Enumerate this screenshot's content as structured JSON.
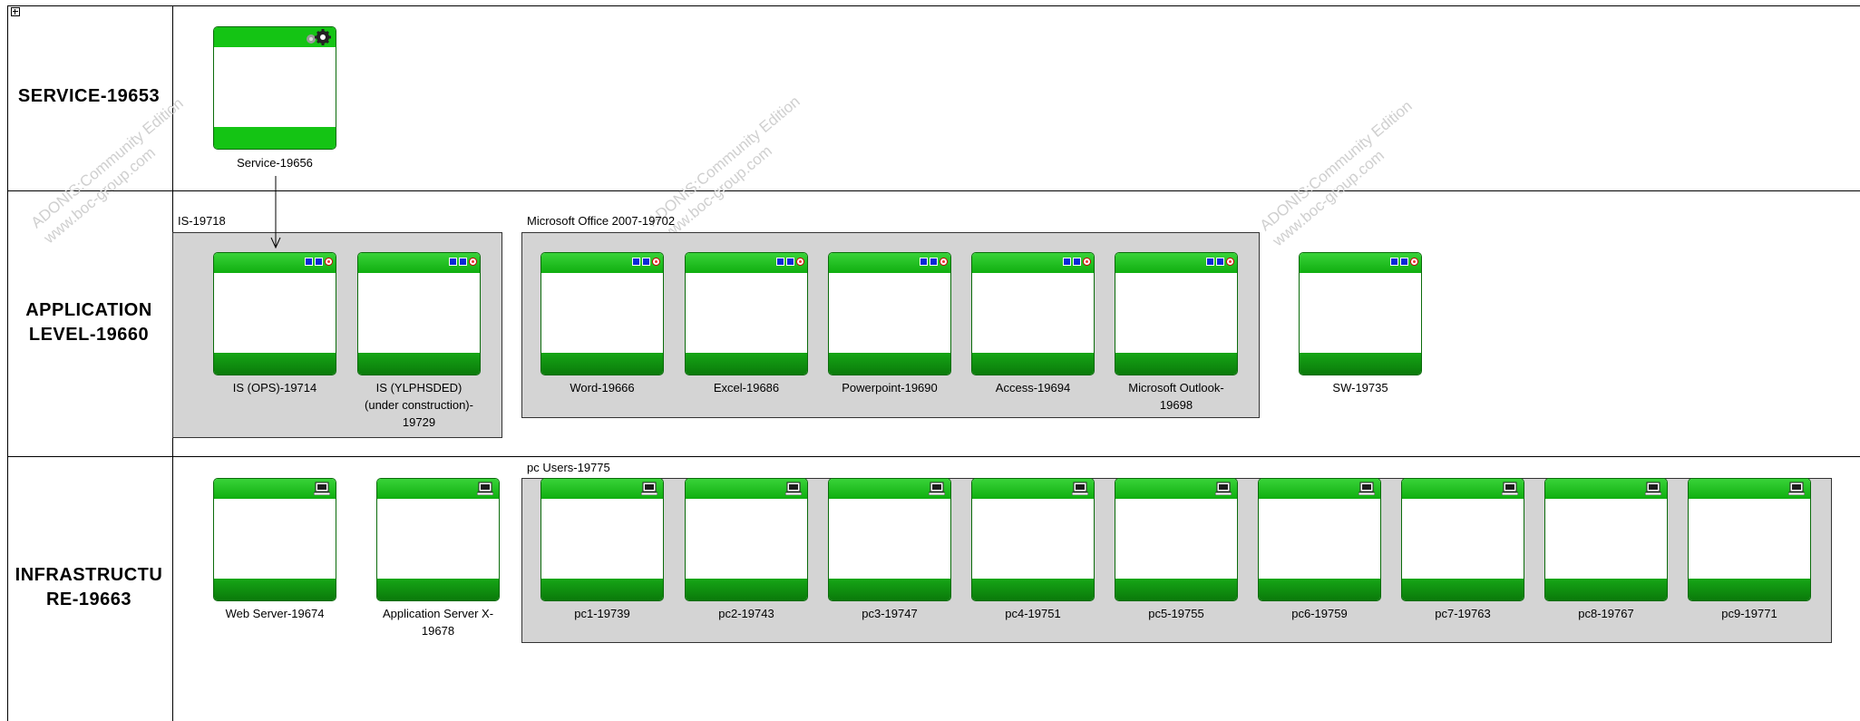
{
  "lanes": [
    {
      "label": "SERVICE-19653"
    },
    {
      "label": "APPLICATION\nLEVEL-19660"
    },
    {
      "label": "INFRASTRUCTU\nRE-19663"
    }
  ],
  "groups": {
    "is": "IS-19718",
    "office": "Microsoft Office 2007-19702",
    "pc_users": "pc Users-19775"
  },
  "service": {
    "label": "Service-19656",
    "icon": "gear-icon"
  },
  "applications": [
    {
      "label": "IS (OPS)-19714"
    },
    {
      "label": "IS (YLPHSDED)\n(under construction)-\n19729"
    },
    {
      "label": "Word-19666"
    },
    {
      "label": "Excel-19686"
    },
    {
      "label": "Powerpoint-19690"
    },
    {
      "label": "Access-19694"
    },
    {
      "label": "Microsoft Outlook-\n19698"
    },
    {
      "label": "SW-19735"
    }
  ],
  "infrastructure": [
    {
      "label": "Web Server-19674"
    },
    {
      "label": "Application Server X-\n19678"
    },
    {
      "label": "pc1-19739"
    },
    {
      "label": "pc2-19743"
    },
    {
      "label": "pc3-19747"
    },
    {
      "label": "pc4-19751"
    },
    {
      "label": "pc5-19755"
    },
    {
      "label": "pc6-19759"
    },
    {
      "label": "pc7-19763"
    },
    {
      "label": "pc8-19767"
    },
    {
      "label": "pc9-19771"
    }
  ],
  "watermark": "ADONIS:Community Edition\nwww.boc-group.com",
  "colors": {
    "object_green": "#14c414",
    "group_fill": "#d4d4d4",
    "app_icon_blue": "#0a28d8"
  }
}
